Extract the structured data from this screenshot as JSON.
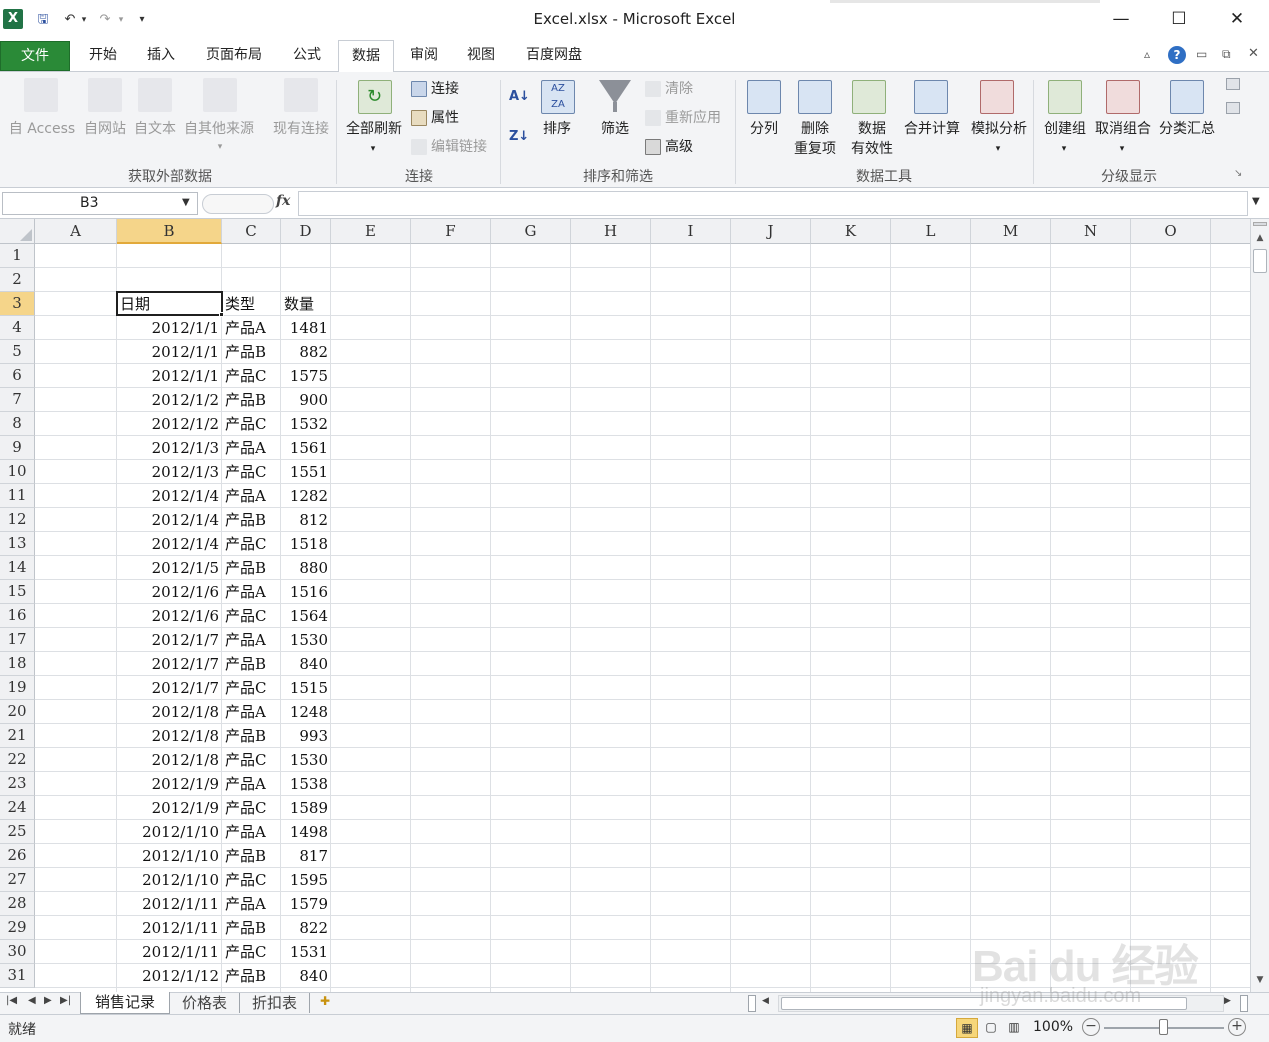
{
  "window": {
    "title": "Excel.xlsx - Microsoft Excel",
    "minimize": "—",
    "maximize": "☐",
    "close": "✕"
  },
  "tabs": {
    "file": "文件",
    "items": [
      "开始",
      "插入",
      "页面布局",
      "公式",
      "数据",
      "审阅",
      "视图",
      "百度网盘"
    ],
    "active": "数据"
  },
  "ribbon": {
    "get_external": {
      "label": "获取外部数据",
      "access": "自 Access",
      "web": "自网站",
      "text": "自文本",
      "other": "自其他来源",
      "existing": "现有连接"
    },
    "connections": {
      "label": "连接",
      "refresh_all": "全部刷新",
      "connections": "连接",
      "properties": "属性",
      "edit_links": "编辑链接"
    },
    "sort_filter": {
      "label": "排序和筛选",
      "sort": "排序",
      "filter": "筛选",
      "clear": "清除",
      "reapply": "重新应用",
      "advanced": "高级"
    },
    "data_tools": {
      "label": "数据工具",
      "text_to_columns": "分列",
      "remove_dup_1": "删除",
      "remove_dup_2": "重复项",
      "validation_1": "数据",
      "validation_2": "有效性",
      "consolidate": "合并计算",
      "whatif": "模拟分析"
    },
    "outline": {
      "label": "分级显示",
      "group": "创建组",
      "ungroup": "取消组合",
      "subtotal": "分类汇总"
    }
  },
  "formula_bar": {
    "name_box": "B3",
    "fx": "fx",
    "formula": ""
  },
  "columns": [
    "A",
    "B",
    "C",
    "D",
    "E",
    "F",
    "G",
    "H",
    "I",
    "J",
    "K",
    "L",
    "M",
    "N",
    "O"
  ],
  "selected_cell": "B3",
  "header_row": {
    "date": "日期",
    "type": "类型",
    "qty": "数量"
  },
  "rows": [
    {
      "r": "4",
      "date": "2012/1/1",
      "type": "产品A",
      "qty": "1481"
    },
    {
      "r": "5",
      "date": "2012/1/1",
      "type": "产品B",
      "qty": "882"
    },
    {
      "r": "6",
      "date": "2012/1/1",
      "type": "产品C",
      "qty": "1575"
    },
    {
      "r": "7",
      "date": "2012/1/2",
      "type": "产品B",
      "qty": "900"
    },
    {
      "r": "8",
      "date": "2012/1/2",
      "type": "产品C",
      "qty": "1532"
    },
    {
      "r": "9",
      "date": "2012/1/3",
      "type": "产品A",
      "qty": "1561"
    },
    {
      "r": "10",
      "date": "2012/1/3",
      "type": "产品C",
      "qty": "1551"
    },
    {
      "r": "11",
      "date": "2012/1/4",
      "type": "产品A",
      "qty": "1282"
    },
    {
      "r": "12",
      "date": "2012/1/4",
      "type": "产品B",
      "qty": "812"
    },
    {
      "r": "13",
      "date": "2012/1/4",
      "type": "产品C",
      "qty": "1518"
    },
    {
      "r": "14",
      "date": "2012/1/5",
      "type": "产品B",
      "qty": "880"
    },
    {
      "r": "15",
      "date": "2012/1/6",
      "type": "产品A",
      "qty": "1516"
    },
    {
      "r": "16",
      "date": "2012/1/6",
      "type": "产品C",
      "qty": "1564"
    },
    {
      "r": "17",
      "date": "2012/1/7",
      "type": "产品A",
      "qty": "1530"
    },
    {
      "r": "18",
      "date": "2012/1/7",
      "type": "产品B",
      "qty": "840"
    },
    {
      "r": "19",
      "date": "2012/1/7",
      "type": "产品C",
      "qty": "1515"
    },
    {
      "r": "20",
      "date": "2012/1/8",
      "type": "产品A",
      "qty": "1248"
    },
    {
      "r": "21",
      "date": "2012/1/8",
      "type": "产品B",
      "qty": "993"
    },
    {
      "r": "22",
      "date": "2012/1/8",
      "type": "产品C",
      "qty": "1530"
    },
    {
      "r": "23",
      "date": "2012/1/9",
      "type": "产品A",
      "qty": "1538"
    },
    {
      "r": "24",
      "date": "2012/1/9",
      "type": "产品C",
      "qty": "1589"
    },
    {
      "r": "25",
      "date": "2012/1/10",
      "type": "产品A",
      "qty": "1498"
    },
    {
      "r": "26",
      "date": "2012/1/10",
      "type": "产品B",
      "qty": "817"
    },
    {
      "r": "27",
      "date": "2012/1/10",
      "type": "产品C",
      "qty": "1595"
    },
    {
      "r": "28",
      "date": "2012/1/11",
      "type": "产品A",
      "qty": "1579"
    },
    {
      "r": "29",
      "date": "2012/1/11",
      "type": "产品B",
      "qty": "822"
    },
    {
      "r": "30",
      "date": "2012/1/11",
      "type": "产品C",
      "qty": "1531"
    },
    {
      "r": "31",
      "date": "2012/1/12",
      "type": "产品B",
      "qty": "840"
    }
  ],
  "sheets": [
    "销售记录",
    "价格表",
    "折扣表"
  ],
  "active_sheet": "销售记录",
  "status": {
    "ready": "就绪",
    "zoom": "100%"
  },
  "watermark": {
    "brand": "Bai du 经验",
    "url": "jingyan.baidu.com"
  },
  "colors": {
    "file_tab": "#2a8a37",
    "selected_header": "#f5d58a",
    "excel_green": "#217346"
  }
}
